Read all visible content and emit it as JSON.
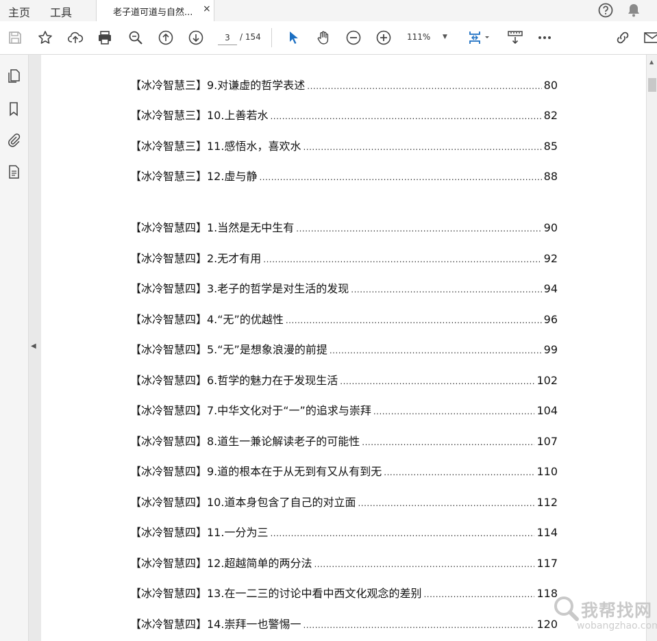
{
  "tabs": {
    "home": "主页",
    "tools": "工具",
    "document": "老子道可道与自然...",
    "close": "×"
  },
  "icons": {
    "help": "help-icon",
    "notifications": "bell-icon",
    "save": "save-icon",
    "bookmark": "star-icon",
    "upload": "cloud-upload-icon",
    "print": "printer-icon",
    "zoom_search": "zoom-magnifier-icon",
    "prev_page": "arrow-up-circle-icon",
    "next_page": "arrow-down-circle-icon",
    "select": "cursor-icon",
    "hand": "hand-icon",
    "zoom_out": "minus-circle-icon",
    "zoom_in": "plus-circle-icon",
    "fit": "fit-page-icon",
    "scroll_mode": "scroll-mode-icon",
    "more": "more-icon",
    "link": "link-icon",
    "email": "email-icon"
  },
  "toolbar": {
    "page_current": "3",
    "page_total": "/ 154",
    "zoom_level": "111%",
    "zoom_arrow": "▼"
  },
  "sidebar": {
    "collapse": "◀",
    "scroll_up": "▲"
  },
  "toc": [
    {
      "title": "【冰冷智慧三】9.对谦虚的哲学表述",
      "page": "80"
    },
    {
      "title": "【冰冷智慧三】10.上善若水",
      "page": "82"
    },
    {
      "title": "【冰冷智慧三】11.感悟水，喜欢水",
      "page": "85"
    },
    {
      "title": "【冰冷智慧三】12.虚与静",
      "page": "88"
    },
    {
      "title": "【冰冷智慧四】1.当然是无中生有",
      "page": "90"
    },
    {
      "title": "【冰冷智慧四】2.无才有用",
      "page": "92"
    },
    {
      "title": "【冰冷智慧四】3.老子的哲学是对生活的发现",
      "page": "94"
    },
    {
      "title": "【冰冷智慧四】4.“无”的优越性",
      "page": "96"
    },
    {
      "title": "【冰冷智慧四】5.“无”是想象浪漫的前提",
      "page": "99"
    },
    {
      "title": "【冰冷智慧四】6.哲学的魅力在于发现生活",
      "page": "102"
    },
    {
      "title": "【冰冷智慧四】7.中华文化对于“一”的追求与崇拜",
      "page": "104"
    },
    {
      "title": "【冰冷智慧四】8.道生一兼论解读老子的可能性",
      "page": "107"
    },
    {
      "title": "【冰冷智慧四】9.道的根本在于从无到有又从有到无",
      "page": "110"
    },
    {
      "title": "【冰冷智慧四】10.道本身包含了自己的对立面",
      "page": "112"
    },
    {
      "title": "【冰冷智慧四】11.一分为三",
      "page": "114"
    },
    {
      "title": "【冰冷智慧四】12.超越简单的两分法",
      "page": "117"
    },
    {
      "title": "【冰冷智慧四】13.在一二三的讨论中看中西文化观念的差别",
      "page": "118"
    },
    {
      "title": "【冰冷智慧四】14.崇拜一也警惕一",
      "page": "120"
    }
  ],
  "watermark": {
    "cn": "我帮找网",
    "en": "wobangzhao.com"
  }
}
